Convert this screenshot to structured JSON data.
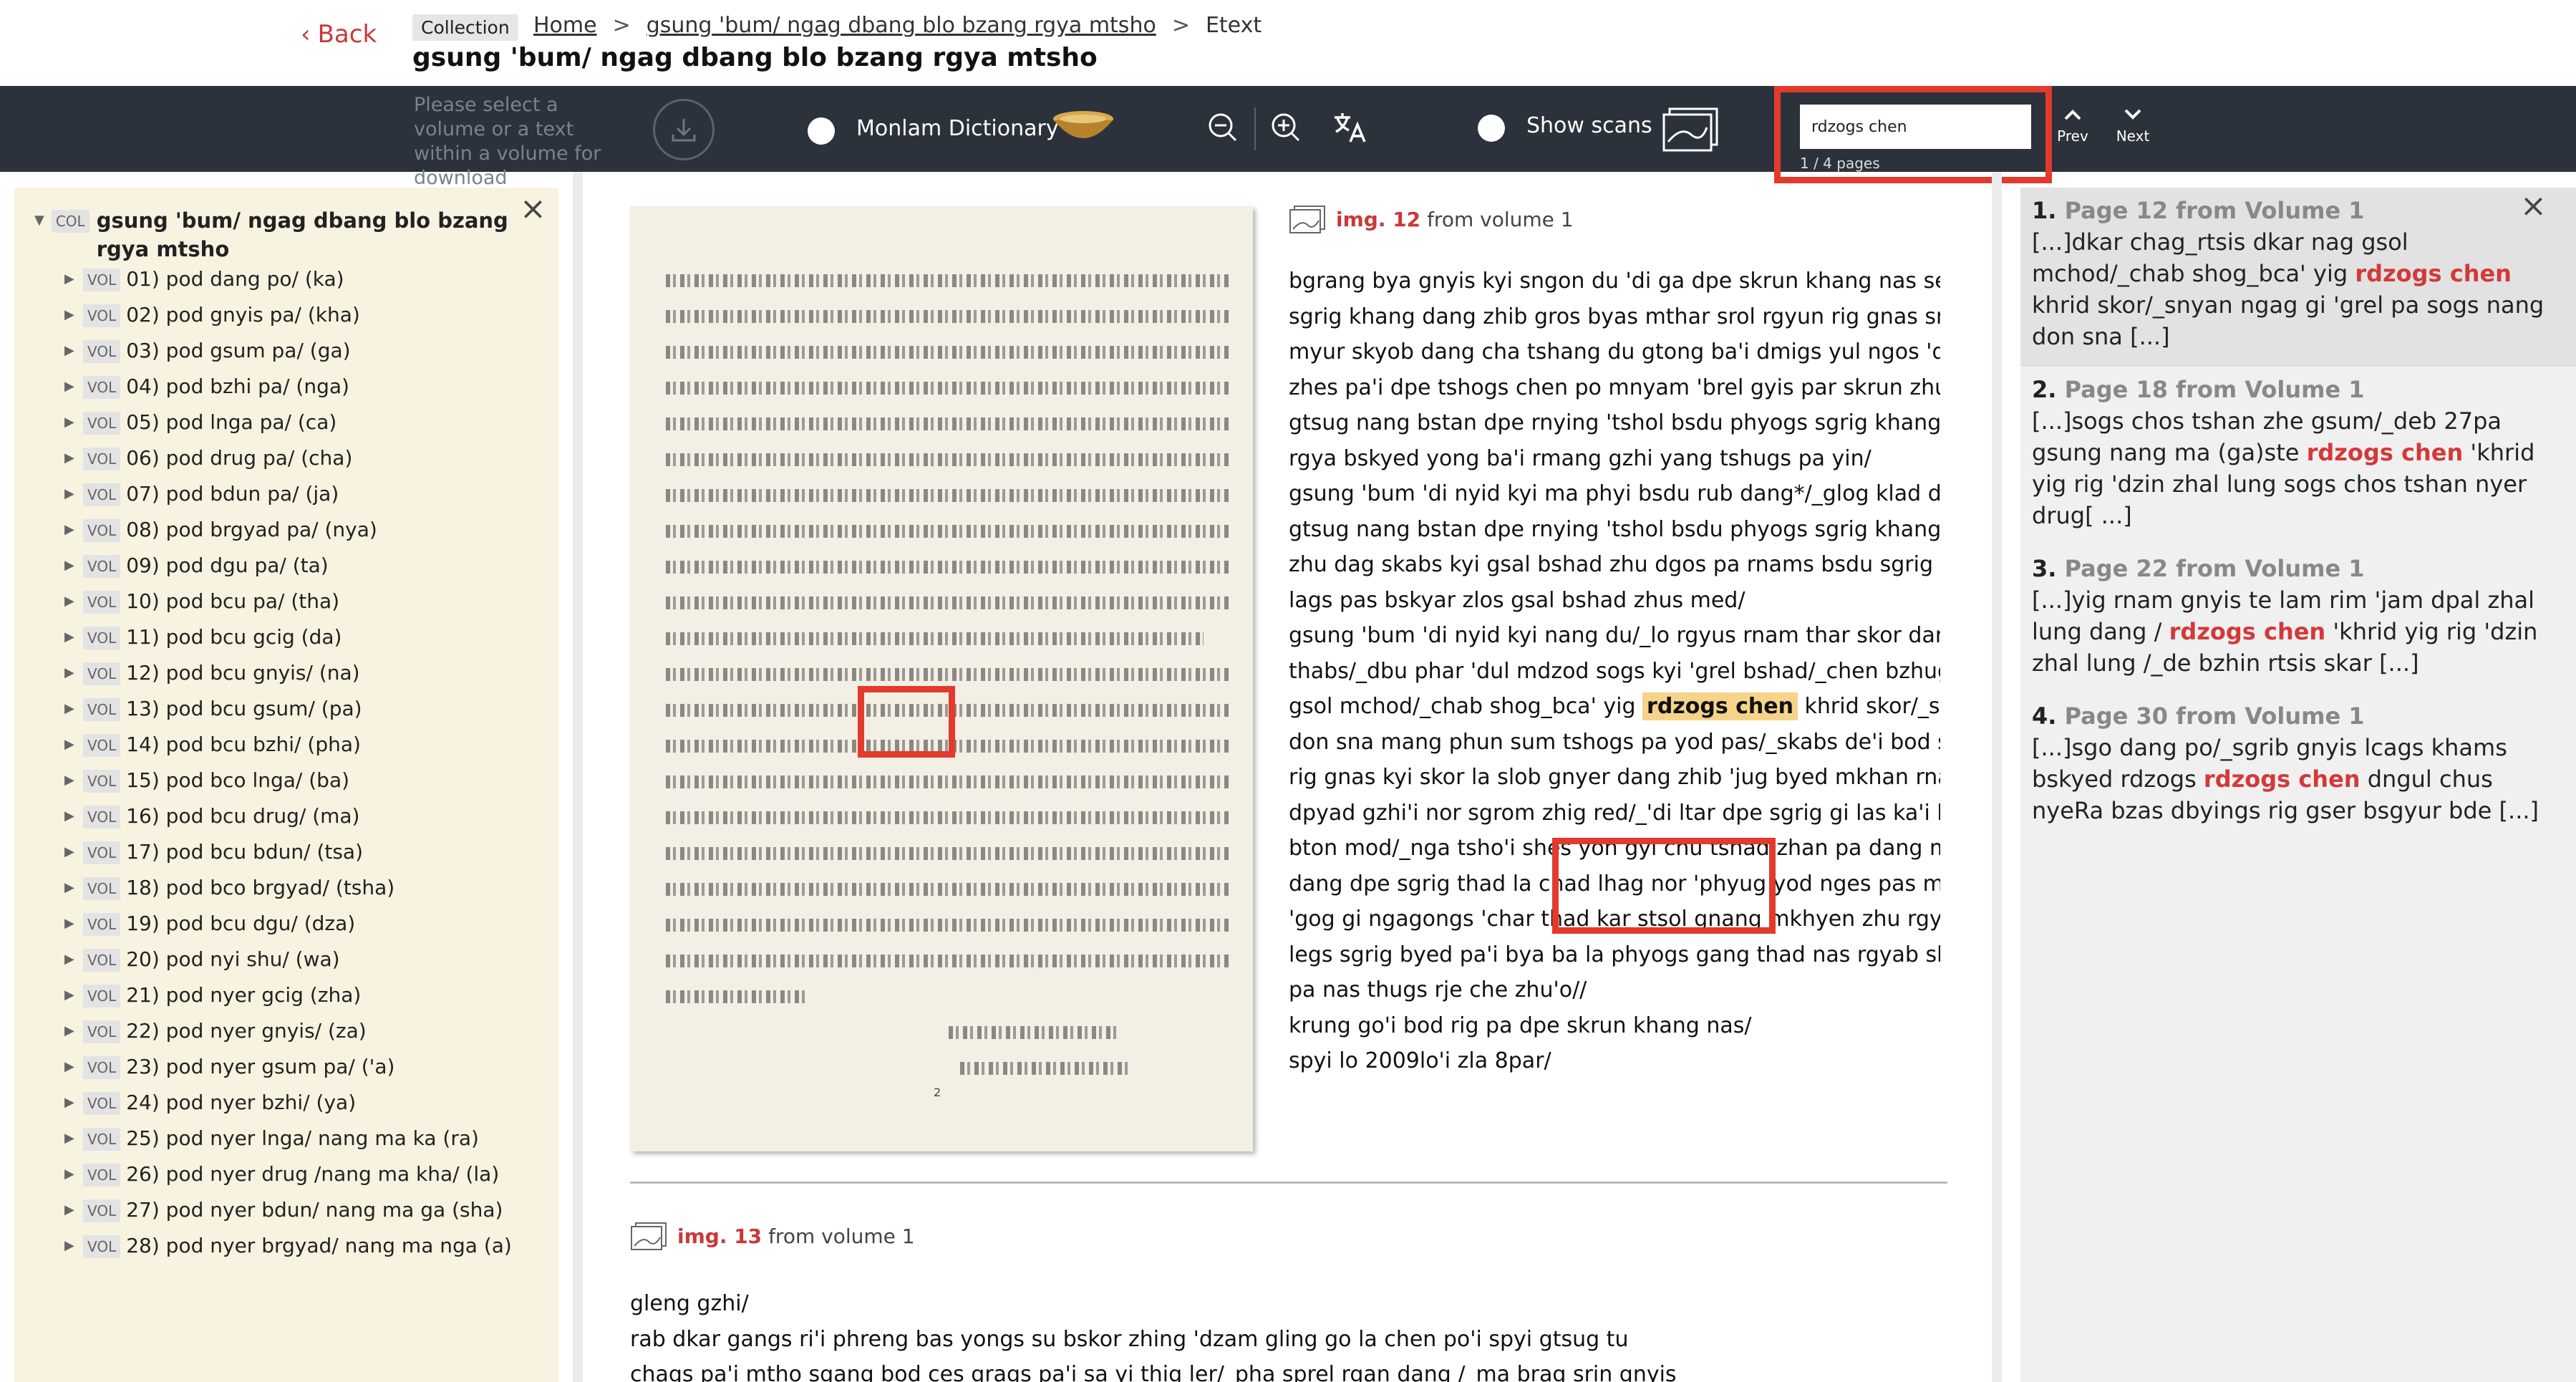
{
  "header": {
    "back_label": "Back",
    "collection_badge": "Collection",
    "breadcrumb": [
      "Home",
      "gsung 'bum/ ngag dbang blo bzang rgya mtsho",
      "Etext"
    ],
    "breadcrumb_sep": ">",
    "title": "gsung 'bum/ ngag dbang blo bzang rgya mtsho"
  },
  "toolbar": {
    "download_text": "Please select a volume or a text within a volume for download",
    "dictionary_label": "Monlam Dictionary",
    "show_scans_label": "Show scans",
    "search_value": "rdzogs chen",
    "search_count": "1 / 4 pages",
    "prev_label": "Prev",
    "next_label": "Next",
    "icons": [
      "download-icon",
      "dictionary-bowl-icon",
      "zoom-out-icon",
      "zoom-in-icon",
      "translate-icon",
      "scans-icon",
      "chevron-up-icon",
      "chevron-down-icon"
    ]
  },
  "sidebar": {
    "root_tag": "COL",
    "root_title": "gsung 'bum/ ngag dbang blo bzang rgya mtsho",
    "vol_tag": "VOL",
    "volumes": [
      "01) pod dang po/ (ka)",
      "02) pod gnyis pa/ (kha)",
      "03) pod gsum pa/ (ga)",
      "04) pod bzhi pa/ (nga)",
      "05) pod lnga pa/ (ca)",
      "06) pod drug pa/ (cha)",
      "07) pod bdun pa/ (ja)",
      "08) pod brgyad pa/ (nya)",
      "09) pod dgu pa/ (ta)",
      "10) pod bcu pa/ (tha)",
      "11) pod bcu gcig (da)",
      "12) pod bcu gnyis/ (na)",
      "13) pod bcu gsum/ (pa)",
      "14) pod bcu bzhi/ (pha)",
      "15) pod bco lnga/ (ba)",
      "16) pod bcu drug/ (ma)",
      "17) pod bcu bdun/ (tsa)",
      "18) pod bco brgyad/ (tsha)",
      "19) pod bcu dgu/ (dza)",
      "20) pod nyi shu/ (wa)",
      "21) pod nyer gcig (zha)",
      "22) pod nyer gnyis/ (za)",
      "23) pod nyer gsum pa/ ('a)",
      "24) pod nyer bzhi/ (ya)",
      "25) pod nyer lnga/ nang ma ka (ra)",
      "26) pod nyer drug /nang ma kha/ (la)",
      "27) pod nyer bdun/ nang ma ga (sha)",
      "28) pod nyer brgyad/ nang ma nga (a)"
    ]
  },
  "main": {
    "img1_label": "img. 12",
    "img1_suffix": "from volume 1",
    "img1_lines": [
      "bgrang bya gnyis kyi sngon du 'di ga dpe skrun khang nas ser gtsug dpe",
      "sgrig khang dang zhib gros byas mthar srol rgyun rig gnas srung skyob",
      "myur skyob dang cha tshang du gtong ba'i dmigs yul ngos 'dzin gcig gi",
      "zhes pa'i dpe tshogs chen po mnyam 'brel gyis par skrun zhu rgyu'i gros",
      "gtsug nang bstan dpe rnying 'tshol bsdu phyogs sgrig khang nas mdzad",
      "rgya bskyed yong ba'i rmang gzhi yang tshugs pa yin/",
      "gsung 'bum 'di nyid kyi ma phyi bsdu rub dang*/_glog klad du 'jug pa/",
      "gtsug nang bstan dpe rnying 'tshol bsdu phyogs sgrig khang nas mdzad",
      "zhu dag skabs kyi gsal bshad zhu dgos pa rnams bsdu sgrig gsal bshad",
      "lags pas bskyar zlos gsal bshad zhus med/",
      "gsung 'bum 'di nyid kyi nang du/_lo rgyus rnam thar skor dang /_gsan",
      "thabs/_dbu phar 'dul mdzod sogs kyi 'grel bshad/_chen bzhugs dkar chag",
      "gsol mchod/_chab shog_bca' yig",
      "khrid skor/_snyan ngag",
      "don sna mang phun sum tshogs pa yod pas/_skabs de'i bod sa gnas kyi",
      "rig gnas kyi skor la slob gnyer dang zhib 'jug byed mkhan rnams la rin",
      "dpyad gzhi'i nor sgrom zhig red/_'di ltar dpe sgrig gi las ka'i brgyud rim",
      "bton mod/_nga tsho'i shes yon gyi chu tshad zhan pa dang mi sna nyung",
      "dang dpe sgrig thad la chad lhag nor 'phyug yod nges pas mkhyen lda",
      "'gog gi ngagongs 'char thad kar stsol gnang mkhyen zhu rgyu dang*/_",
      "legs sgrig byed pa'i bya ba la phyogs gang thad nas rgyab skyor gnang",
      "pa nas thugs rje che zhu'o//",
      "krung go'i bod rig pa dpe skrun khang nas/",
      "spyi lo 2009lo'i zla 8par/"
    ],
    "img1_highlight": "rdzogs chen",
    "img2_label": "img. 13",
    "img2_suffix": "from volume 1",
    "img2_lines": [
      "gleng gzhi/",
      "rab dkar gangs ri'i phreng bas yongs su bskor zhing 'dzam gling go la chen po'i spyi gtsug tu",
      "chags pa'i mtho sgang bod ces grags pa'i sa yi thig ler/_pha sprel rgan dang /_ma brag srin gnyis"
    ],
    "scan_page_number": "2"
  },
  "results": [
    {
      "num": "1.",
      "title": "Page 12 from Volume 1",
      "pre": "[...]dkar chag_rtsis dkar nag gsol mchod/_chab shog_bca' yig ",
      "match": "rdzogs chen",
      "post": " khrid skor/_snyan ngag gi 'grel pa sogs nang don sna [...]"
    },
    {
      "num": "2.",
      "title": "Page 18 from Volume 1",
      "pre": "[...]sogs chos tshan zhe gsum/_deb 27pa gsung nang ma (ga)ste ",
      "match": "rdzogs chen",
      "post": " 'khrid yig rig 'dzin zhal lung sogs chos tshan nyer drug[ ...]"
    },
    {
      "num": "3.",
      "title": "Page 22 from Volume 1",
      "pre": "[...]yig rnam gnyis te lam rim 'jam dpal zhal lung dang / ",
      "match": "rdzogs chen",
      "post": " 'khrid yig rig 'dzin zhal lung /_de bzhin rtsis skar [...]"
    },
    {
      "num": "4.",
      "title": "Page 30 from Volume 1",
      "pre": "[...]sgo dang po/_sgrib gnyis lcags khams bskyed rdzogs ",
      "match": "rdzogs chen",
      "post": " dngul chus nyeRa bzas dbyings rig gser bsgyur bde [...]"
    }
  ]
}
